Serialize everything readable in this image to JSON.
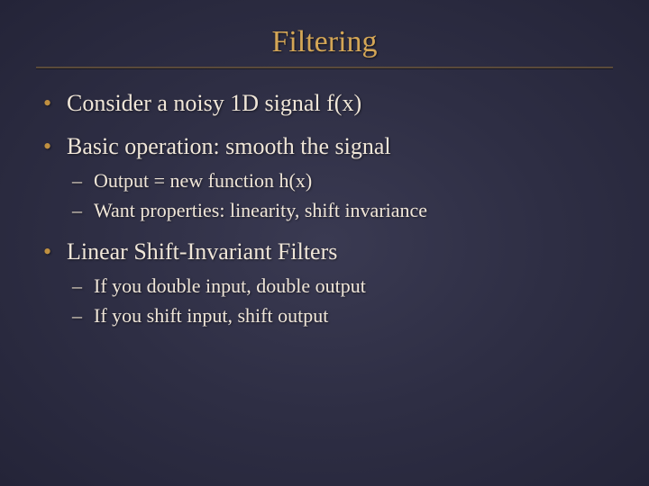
{
  "title": "Filtering",
  "bullets": [
    {
      "text": "Consider a noisy 1D signal f(x)",
      "sub": []
    },
    {
      "text": "Basic operation: smooth the signal",
      "sub": [
        "Output = new function h(x)",
        "Want properties: linearity, shift invariance"
      ]
    },
    {
      "text": "Linear Shift-Invariant Filters",
      "sub": [
        "If you double input, double output",
        "If you shift input, shift output"
      ]
    }
  ]
}
